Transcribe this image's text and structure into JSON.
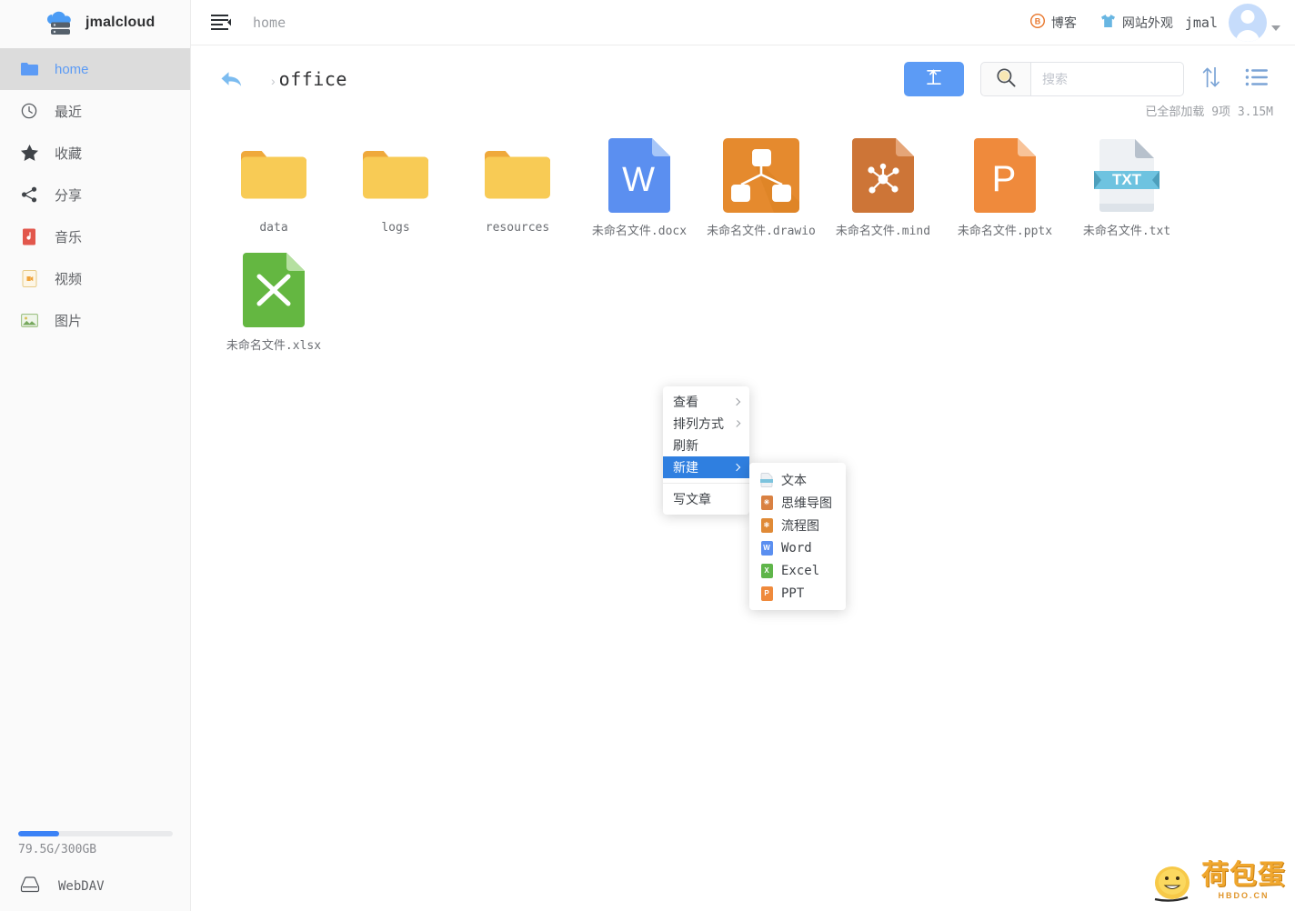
{
  "brand": {
    "name": "jmalcloud",
    "logo_icon": "cloud-server-icon"
  },
  "sidebar": {
    "items": [
      {
        "label": "home",
        "icon": "folder-icon",
        "active": true
      },
      {
        "label": "最近",
        "icon": "clock-icon",
        "active": false
      },
      {
        "label": "收藏",
        "icon": "star-icon",
        "active": false
      },
      {
        "label": "分享",
        "icon": "share-icon",
        "active": false
      },
      {
        "label": "音乐",
        "icon": "music-file-icon",
        "active": false
      },
      {
        "label": "视频",
        "icon": "video-file-icon",
        "active": false
      },
      {
        "label": "图片",
        "icon": "image-file-icon",
        "active": false
      }
    ],
    "storage": {
      "text": "79.5G/300GB",
      "percent": 26.5,
      "fill_color": "#3b82f6"
    },
    "webdav": {
      "label": "WebDAV",
      "icon": "drive-icon"
    }
  },
  "topbar": {
    "menu_icon": "hamburger-icon",
    "path": "home",
    "links": [
      {
        "label": "博客",
        "icon": "blog-icon"
      },
      {
        "label": "网站外观",
        "icon": "tshirt-icon"
      }
    ],
    "user": "jmal",
    "avatar_icon": "user-avatar-icon",
    "caret_icon": "caret-down-icon"
  },
  "toolbar": {
    "back_icon": "back-arrow-icon",
    "breadcrumb_sep": "›",
    "current_folder": "office",
    "upload_icon": "upload-icon",
    "search_icon": "search-icon",
    "search_placeholder": "搜索",
    "search_value": "",
    "sort_icon": "sort-updown-icon",
    "view_icon": "list-view-icon",
    "load_status": "已全部加载  9项  3.15M"
  },
  "files": [
    {
      "name": "data",
      "type": "folder",
      "icon": "folder-icon"
    },
    {
      "name": "logs",
      "type": "folder",
      "icon": "folder-icon"
    },
    {
      "name": "resources",
      "type": "folder",
      "icon": "folder-icon"
    },
    {
      "name": "未命名文件.docx",
      "type": "word",
      "icon": "word-file-icon"
    },
    {
      "name": "未命名文件.drawio",
      "type": "drawio",
      "icon": "drawio-file-icon"
    },
    {
      "name": "未命名文件.mind",
      "type": "mind",
      "icon": "mindmap-file-icon"
    },
    {
      "name": "未命名文件.pptx",
      "type": "ppt",
      "icon": "ppt-file-icon"
    },
    {
      "name": "未命名文件.txt",
      "type": "txt",
      "icon": "txt-file-icon"
    },
    {
      "name": "未命名文件.xlsx",
      "type": "excel",
      "icon": "excel-file-icon"
    }
  ],
  "context_menu": {
    "items": [
      {
        "label": "查看",
        "has_sub": true,
        "selected": false
      },
      {
        "label": "排列方式",
        "has_sub": true,
        "selected": false
      },
      {
        "label": "刷新",
        "has_sub": false,
        "selected": false
      },
      {
        "label": "新建",
        "has_sub": true,
        "selected": true
      },
      {
        "label": "写文章",
        "has_sub": false,
        "selected": false
      }
    ],
    "submenu": {
      "items": [
        {
          "label": "文本",
          "icon": "txt-file-icon",
          "glyph": "",
          "color": "#8fc3d8"
        },
        {
          "label": "思维导图",
          "icon": "mindmap-file-icon",
          "glyph": "",
          "color": "#d98142"
        },
        {
          "label": "流程图",
          "icon": "drawio-file-icon",
          "glyph": "",
          "color": "#e08a36"
        },
        {
          "label": "Word",
          "icon": "word-file-icon",
          "glyph": "W",
          "color": "#5b8ff0"
        },
        {
          "label": "Excel",
          "icon": "excel-file-icon",
          "glyph": "X",
          "color": "#5fb54a"
        },
        {
          "label": "PPT",
          "icon": "ppt-file-icon",
          "glyph": "P",
          "color": "#ef8a3c"
        }
      ]
    }
  },
  "watermark": {
    "title": "荷包蛋",
    "subtitle": "HBDO.CN",
    "icon": "egg-mascot-icon"
  },
  "colors": {
    "accent": "#5c9bf5",
    "sidebar_bg": "#fafafa",
    "active_bg": "#dcdcdc",
    "menu_selected": "#2f7fe0",
    "folder": "#f8cb55"
  }
}
